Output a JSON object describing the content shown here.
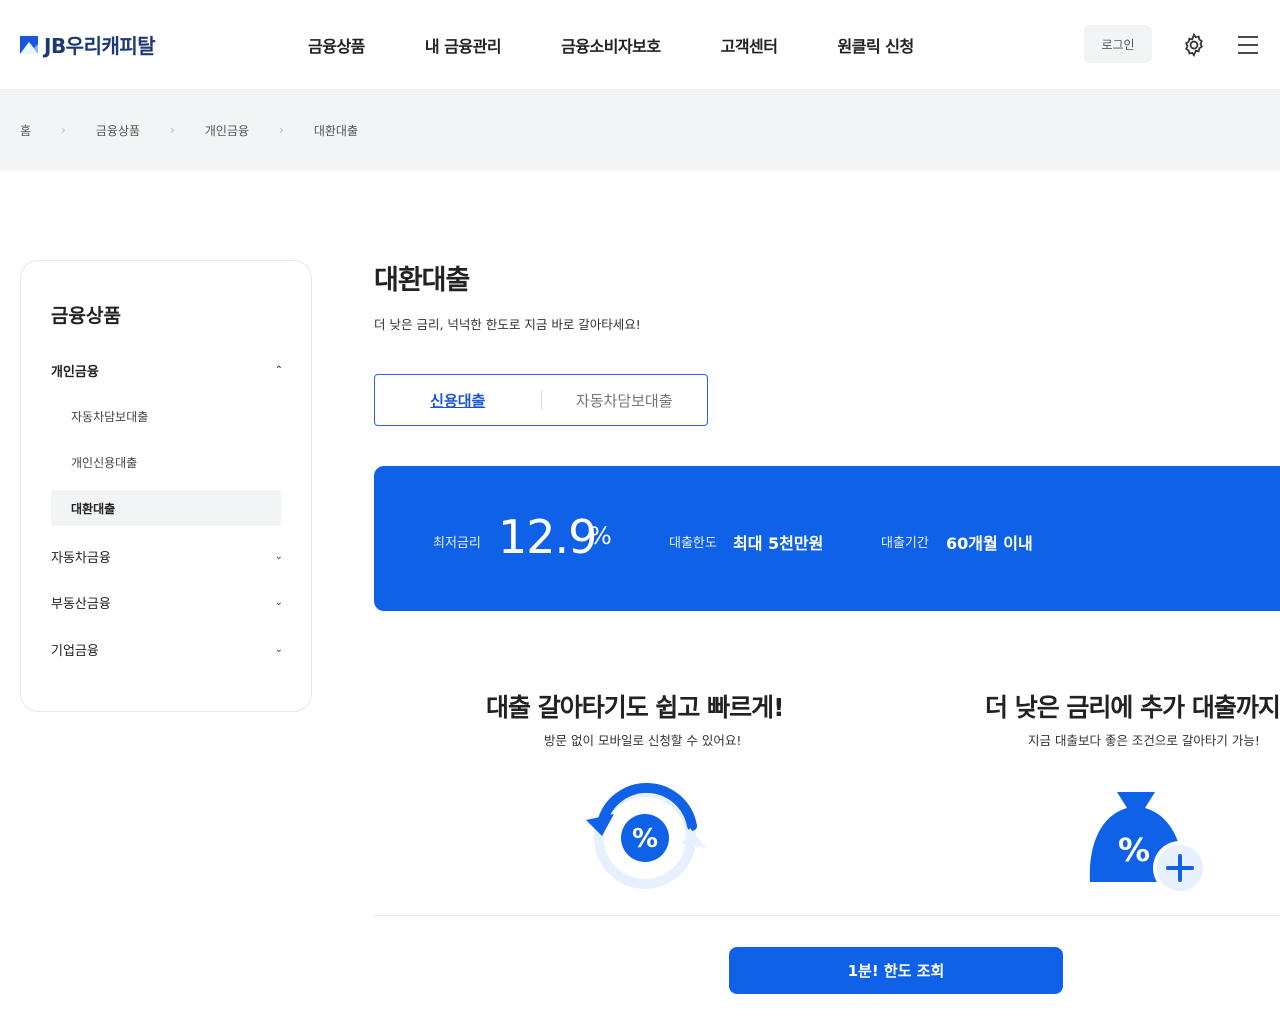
{
  "header": {
    "logo_text": "JB우리캐피탈",
    "nav": [
      "금융상품",
      "내 금융관리",
      "금융소비자보호",
      "고객센터",
      "원클릭 신청"
    ],
    "login_label": "로그인"
  },
  "breadcrumb": [
    "홈",
    "금융상품",
    "개인금융",
    "대환대출"
  ],
  "sidebar": {
    "title": "금융상품",
    "categories": [
      {
        "label": "개인금융",
        "expanded": true
      },
      {
        "label": "자동차금융",
        "expanded": false
      },
      {
        "label": "부동산금융",
        "expanded": false
      },
      {
        "label": "기업금융",
        "expanded": false
      }
    ],
    "sub_items": [
      "자동차담보대출",
      "개인신용대출",
      "대환대출"
    ],
    "active_sub": "대환대출"
  },
  "main": {
    "title": "대환대출",
    "description": "더 낮은 금리, 넉넉한 한도로 지금 바로 갈아타세요!",
    "tabs": [
      {
        "label": "신용대출",
        "active": true
      },
      {
        "label": "자동차담보대출",
        "active": false
      }
    ],
    "banner": {
      "rate_label": "최저금리",
      "rate_value": "12.9",
      "rate_unit": "%",
      "limit_label": "대출한도",
      "limit_value": "최대 5천만원",
      "period_label": "대출기간",
      "period_value": "60개월 이내"
    },
    "features": [
      {
        "title": "대출 갈아타기도 쉽고 빠르게!",
        "subtitle": "방문 없이 모바일로 신청할 수 있어요!",
        "icon": "refresh-percent-icon"
      },
      {
        "title": "더 낮은 금리에 추가 대출까지",
        "subtitle": "지금 대출보다 좋은 조건으로 갈아타기 가능!",
        "icon": "money-bag-plus-icon"
      }
    ],
    "cta_label": "1분! 한도 조회"
  },
  "colors": {
    "brand": "#0f62e8",
    "navy": "#1d3b70",
    "bg_gray": "#f3f4f6"
  }
}
